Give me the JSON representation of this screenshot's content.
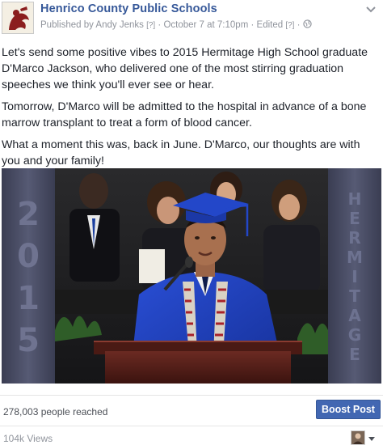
{
  "post": {
    "page_name": "Henrico County Public Schools",
    "published_by": "Published by Andy Jenks",
    "help_marker": "[?]",
    "separator": "·",
    "date": "October 7 at 7:10pm",
    "edited": "Edited",
    "globe_icon": "globe-icon",
    "paragraphs": [
      "Let's send some positive vibes to 2015 Hermitage High School graduate D'Marco Jackson, who delivered one of the most stirring graduation speeches we think you'll ever see or hear.",
      "Tomorrow, D'Marco will be admitted to the hospital in advance of a bone marrow transplant to treat a form of blood cancer.",
      "What a moment this was, back in June. D'Marco, our thoughts are with you and your family!"
    ]
  },
  "video": {
    "year_digits": [
      "2",
      "0",
      "1",
      "5"
    ],
    "school_letters": [
      "H",
      "E",
      "R",
      "M",
      "I",
      "T",
      "A",
      "G",
      "E"
    ]
  },
  "stats": {
    "reach": "278,003 people reached",
    "boost_label": "Boost Post",
    "views": "104k Views"
  },
  "colors": {
    "link_blue": "#365899",
    "button_blue": "#4267b2",
    "gown_blue": "#1f3fb8"
  }
}
